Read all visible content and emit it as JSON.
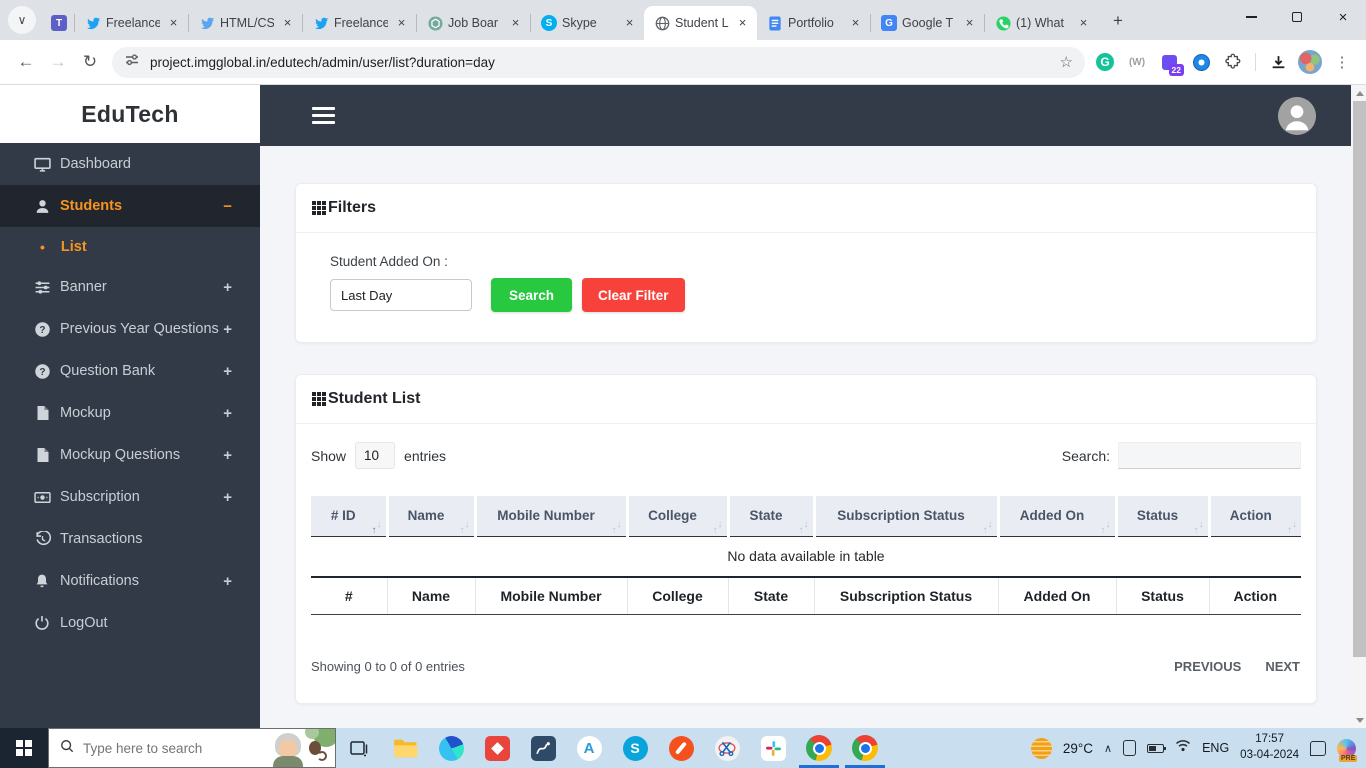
{
  "glyphs": {
    "close": "×",
    "plus": "+",
    "minus": "−",
    "chevron_down": "∨",
    "chevron_up": "∧",
    "back": "←",
    "forward": "→",
    "reload": "↻",
    "star": "☆",
    "kebab": "⋮",
    "sort_asc": "↑",
    "sort_desc": "↓",
    "bullet": "•",
    "new_tab": "+"
  },
  "browser": {
    "tabs": [
      {
        "label": "Freelance"
      },
      {
        "label": "HTML/CS"
      },
      {
        "label": "Freelance"
      },
      {
        "label": "Job Boar"
      },
      {
        "label": "Skype"
      },
      {
        "label": "Student L",
        "active": true
      },
      {
        "label": "Portfolio"
      },
      {
        "label": "Google T"
      },
      {
        "label": "(1) What"
      }
    ],
    "url": "project.imgglobal.in/edutech/admin/user/list?duration=day",
    "extension_badge": "22",
    "wayback_label": "(W)"
  },
  "icons": {
    "tab_favicons": [
      "teams-icon",
      "twitter-icon",
      "twitter-icon",
      "twitter-icon",
      "chatgpt-icon",
      "skype-icon",
      "globe-icon",
      "docs-icon",
      "translate-icon",
      "whatsapp-icon"
    ],
    "toolbar": [
      "back-icon",
      "forward-icon",
      "reload-icon",
      "site-info-icon",
      "bookmark-star-icon",
      "grammarly-icon",
      "wayback-machine-icon",
      "extension-badge-icon",
      "colorzilla-icon",
      "extensions-puzzle-icon",
      "download-icon",
      "profile-avatar",
      "menu-kebab-icon"
    ],
    "sidebar": [
      "monitor-icon",
      "user-icon",
      "sliders-icon",
      "question-circle-icon",
      "file-icon",
      "cash-icon",
      "history-icon",
      "bell-icon",
      "power-icon"
    ],
    "taskbar": [
      "windows-start-icon",
      "search-icon",
      "task-view-icon",
      "file-explorer-icon",
      "edge-icon",
      "remote-app-icon",
      "tablet-app-icon",
      "letter-a-app-icon",
      "skype-icon",
      "pen-app-icon",
      "snipping-tool-icon",
      "slack-icon",
      "chrome-icon",
      "chrome-icon",
      "weather-icon",
      "chevron-up-icon",
      "device-icon",
      "battery-icon",
      "wifi-icon",
      "notification-icon",
      "copilot-icon"
    ]
  },
  "sidebar": {
    "brand": "EduTech",
    "items": [
      {
        "label": "Dashboard"
      },
      {
        "label": "Students",
        "expander": "−",
        "active": true
      },
      {
        "label": "List",
        "submenu": true
      },
      {
        "label": "Banner",
        "expander": "+"
      },
      {
        "label": "Previous Year Questions",
        "expander": "+"
      },
      {
        "label": "Question Bank",
        "expander": "+"
      },
      {
        "label": "Mockup",
        "expander": "+"
      },
      {
        "label": "Mockup Questions",
        "expander": "+"
      },
      {
        "label": "Subscription",
        "expander": "+"
      },
      {
        "label": "Transactions"
      },
      {
        "label": "Notifications",
        "expander": "+"
      },
      {
        "label": "LogOut"
      }
    ]
  },
  "filters": {
    "title": "Filters",
    "field_label": "Student Added On :",
    "field_value": "Last Day",
    "search_button": "Search",
    "clear_button": "Clear Filter"
  },
  "student_list": {
    "title": "Student List",
    "show_label": "Show",
    "entries_value": "10",
    "entries_label": "entries",
    "search_label": "Search:",
    "columns": [
      "# ID",
      "Name",
      "Mobile Number",
      "College",
      "State",
      "Subscription Status",
      "Added On",
      "Status",
      "Action"
    ],
    "footer_columns": [
      "#",
      "Name",
      "Mobile Number",
      "College",
      "State",
      "Subscription Status",
      "Added On",
      "Status",
      "Action"
    ],
    "empty_text": "No data available in table",
    "summary": "Showing 0 to 0 of 0 entries",
    "previous_label": "PREVIOUS",
    "next_label": "NEXT"
  },
  "taskbar": {
    "search_placeholder": "Type here to search",
    "temperature": "29°C",
    "language": "ENG",
    "time": "17:57",
    "date": "03-04-2024",
    "copilot_badge": "PRE"
  },
  "colors": {
    "accent_orange": "#f7941d",
    "sidebar_bg": "#333a47",
    "topbar_bg": "#343b48",
    "green_button": "#28c840",
    "red_button": "#f6423a",
    "taskbar_bg": "#c9dff0"
  }
}
